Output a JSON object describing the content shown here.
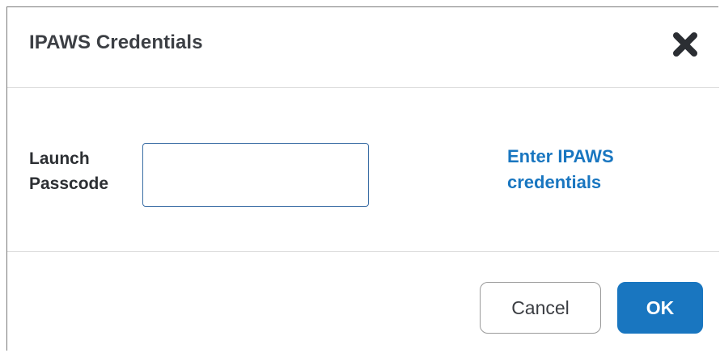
{
  "dialog": {
    "title": "IPAWS Credentials",
    "close_icon": "close-x-icon"
  },
  "form": {
    "passcode_label": "Launch Passcode",
    "passcode_value": "",
    "passcode_placeholder": "",
    "help_link": "Enter IPAWS credentials"
  },
  "footer": {
    "cancel_label": "Cancel",
    "ok_label": "OK"
  },
  "colors": {
    "accent": "#1976c0",
    "title_text": "#3c3f44",
    "divider": "#dcdcdc"
  }
}
